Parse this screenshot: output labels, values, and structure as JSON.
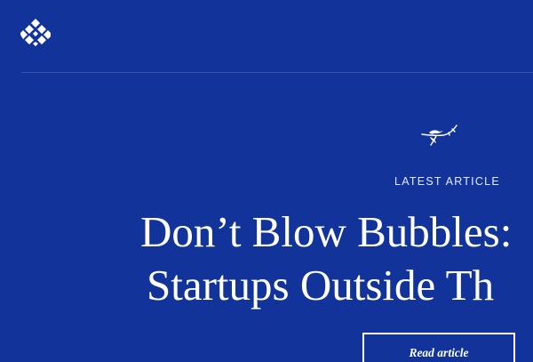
{
  "brand": {
    "logo_icon": "diamond-pattern-logo-icon"
  },
  "hero": {
    "decorative_icon": "bird-branch-icon",
    "kicker": "LATEST ARTICLE",
    "headline_line1": "Don’t Blow Bubbles:",
    "headline_line2": "Startups Outside Th",
    "cta_label": "Read article"
  },
  "colors": {
    "background": "#12349a",
    "text": "#ffffff"
  }
}
